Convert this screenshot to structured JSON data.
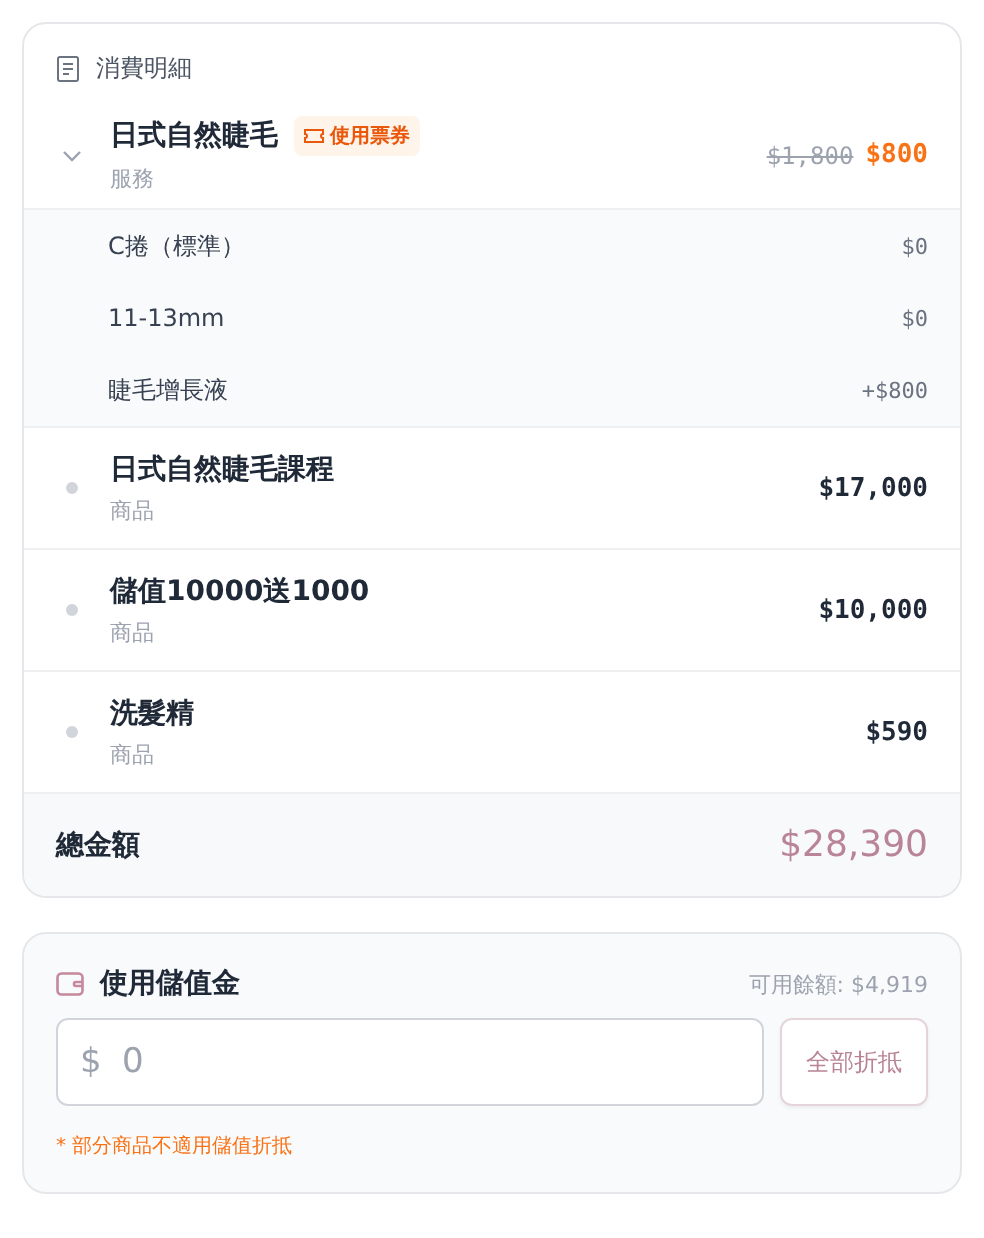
{
  "details": {
    "title": "消費明細",
    "items": [
      {
        "kind": "service",
        "name": "日式自然睫毛",
        "badge": "使用票券",
        "category": "服務",
        "original_price": "$1,800",
        "price": "$800",
        "expanded": true,
        "options": [
          {
            "name": "C捲（標準）",
            "price": "$0"
          },
          {
            "name": "11-13mm",
            "price": "$0"
          },
          {
            "name": "睫毛增長液",
            "price": "+$800"
          }
        ]
      },
      {
        "kind": "product",
        "name": "日式自然睫毛課程",
        "category": "商品",
        "price": "$17,000"
      },
      {
        "kind": "product",
        "name": "儲值10000送1000",
        "category": "商品",
        "price": "$10,000"
      },
      {
        "kind": "product",
        "name": "洗髮精",
        "category": "商品",
        "price": "$590"
      }
    ],
    "total_label": "總金額",
    "total": "$28,390"
  },
  "stored_value": {
    "title": "使用儲值金",
    "balance": "可用餘額: $4,919",
    "currency": "$",
    "placeholder": "0",
    "button": "全部折抵",
    "note": "* 部分商品不適用儲值折抵"
  }
}
